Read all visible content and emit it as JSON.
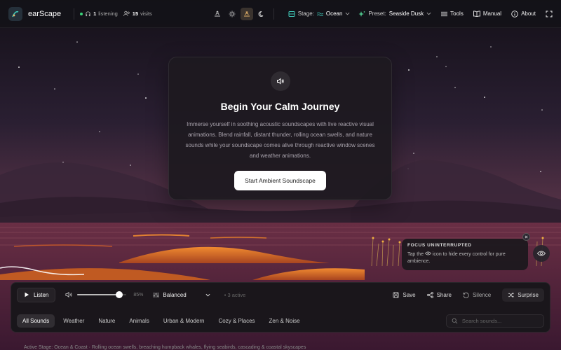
{
  "header": {
    "brand": "earScape",
    "listening_count": "1",
    "listening_label": "listening",
    "visits_count": "15",
    "visits_label": "visits",
    "stage_label": "Stage:",
    "stage_value": "Ocean",
    "preset_label": "Preset:",
    "preset_value": "Seaside Dusk",
    "tools": "Tools",
    "manual": "Manual",
    "about": "About"
  },
  "welcome": {
    "title": "Begin Your Calm Journey",
    "body": "Immerse yourself in soothing acoustic soundscapes with live reactive visual animations. Blend rainfall, distant thunder, rolling ocean swells, and nature sounds while your soundscape comes alive through reactive window scenes and weather animations.",
    "cta": "Start Ambient Soundscape"
  },
  "focus_tip": {
    "title": "FOCUS UNINTERRUPTED",
    "body_before": "Tap the",
    "body_after": "icon to hide every control for pure ambience."
  },
  "controls": {
    "listen": "Listen",
    "volume_percent": "85%",
    "volume_level": 0.85,
    "mode": "Balanced",
    "active": "3 active",
    "save": "Save",
    "share": "Share",
    "silence": "Silence",
    "surprise": "Surprise"
  },
  "tabs": [
    "All Sounds",
    "Weather",
    "Nature",
    "Animals",
    "Urban & Modern",
    "Cozy & Places",
    "Zen & Noise"
  ],
  "search": {
    "placeholder": "Search sounds..."
  },
  "status": {
    "text": "Active Stage: Ocean & Coast  ·  Rolling ocean swells, breaching humpback whales, flying seabirds, cascading & coastal skyscapes"
  },
  "colors": {
    "accent_teal": "#3fc6b6",
    "accent_green": "#4ec38a",
    "sky_top": "#16121c",
    "sky_horizon": "#7a3f52",
    "sand_orange": "#e0782a"
  }
}
